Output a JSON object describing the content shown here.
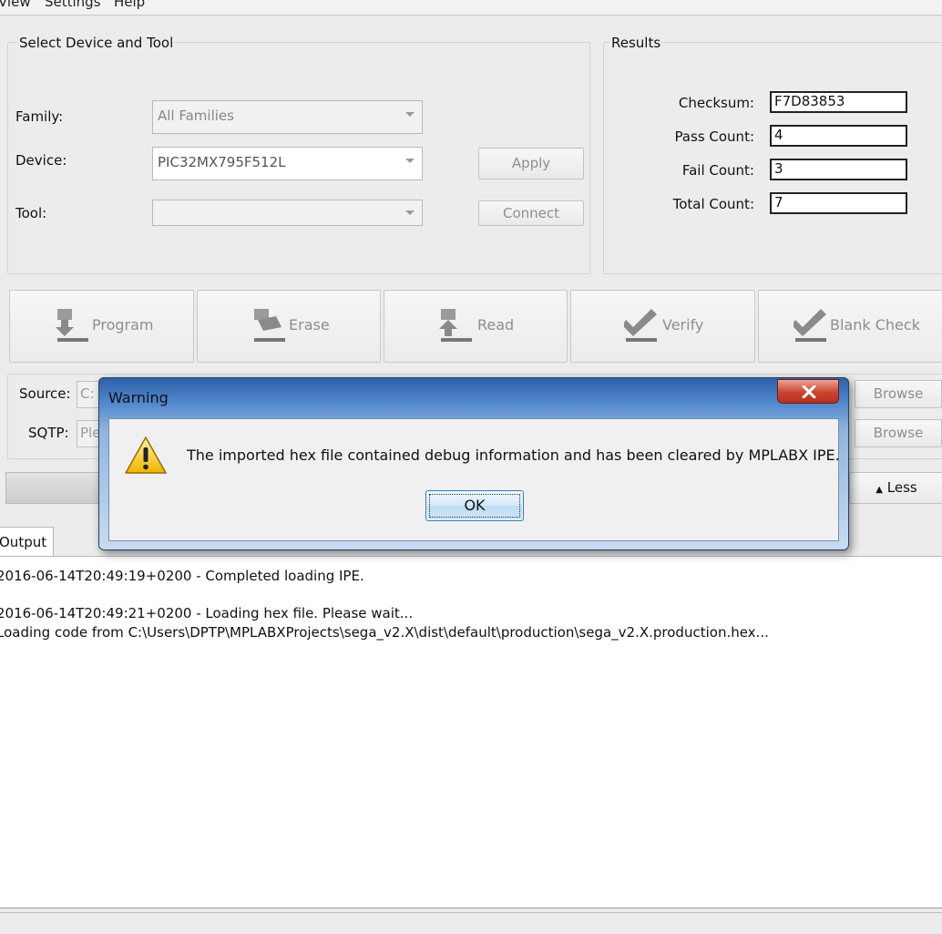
{
  "menu": [
    "View",
    "Settings",
    "Help"
  ],
  "device_panel": {
    "title": "Select Device and Tool",
    "family_label": "Family:",
    "family_value": "All Families",
    "device_label": "Device:",
    "device_value": "PIC32MX795F512L",
    "tool_label": "Tool:",
    "tool_value": "",
    "apply_label": "Apply",
    "connect_label": "Connect"
  },
  "results": {
    "title": "Results",
    "checksum_label": "Checksum:",
    "checksum_value": "F7D83853",
    "pass_label": "Pass Count:",
    "pass_value": "4",
    "fail_label": "Fail Count:",
    "fail_value": "3",
    "total_label": "Total Count:",
    "total_value": "7"
  },
  "actions": {
    "program": "Program",
    "erase": "Erase",
    "read": "Read",
    "verify": "Verify",
    "blank_check": "Blank Check"
  },
  "source": {
    "source_label": "Source:",
    "source_value": "C:",
    "sqtp_label": "SQTP:",
    "sqtp_value": "Ple",
    "browse1": "Browse",
    "browse2": "Browse",
    "less_label": "Less"
  },
  "output": {
    "tab_label": "Output",
    "lines": [
      "2016-06-14T20:49:19+0200 - Completed loading IPE.",
      "2016-06-14T20:49:21+0200 - Loading hex file. Please wait...",
      "Loading code from C:\\Users\\DPTP\\MPLABXProjects\\sega_v2.X\\dist\\default\\production\\sega_v2.X.production.hex..."
    ]
  },
  "dialog": {
    "title": "Warning",
    "message": "The imported hex file contained debug information and has been cleared by MPLABX IPE.",
    "ok_label": "OK",
    "icon": "warning-icon"
  },
  "colors": {
    "dialog_title_blue": "#4f86cc",
    "close_red": "#c8442f",
    "ok_blue": "#bfdcf3"
  }
}
